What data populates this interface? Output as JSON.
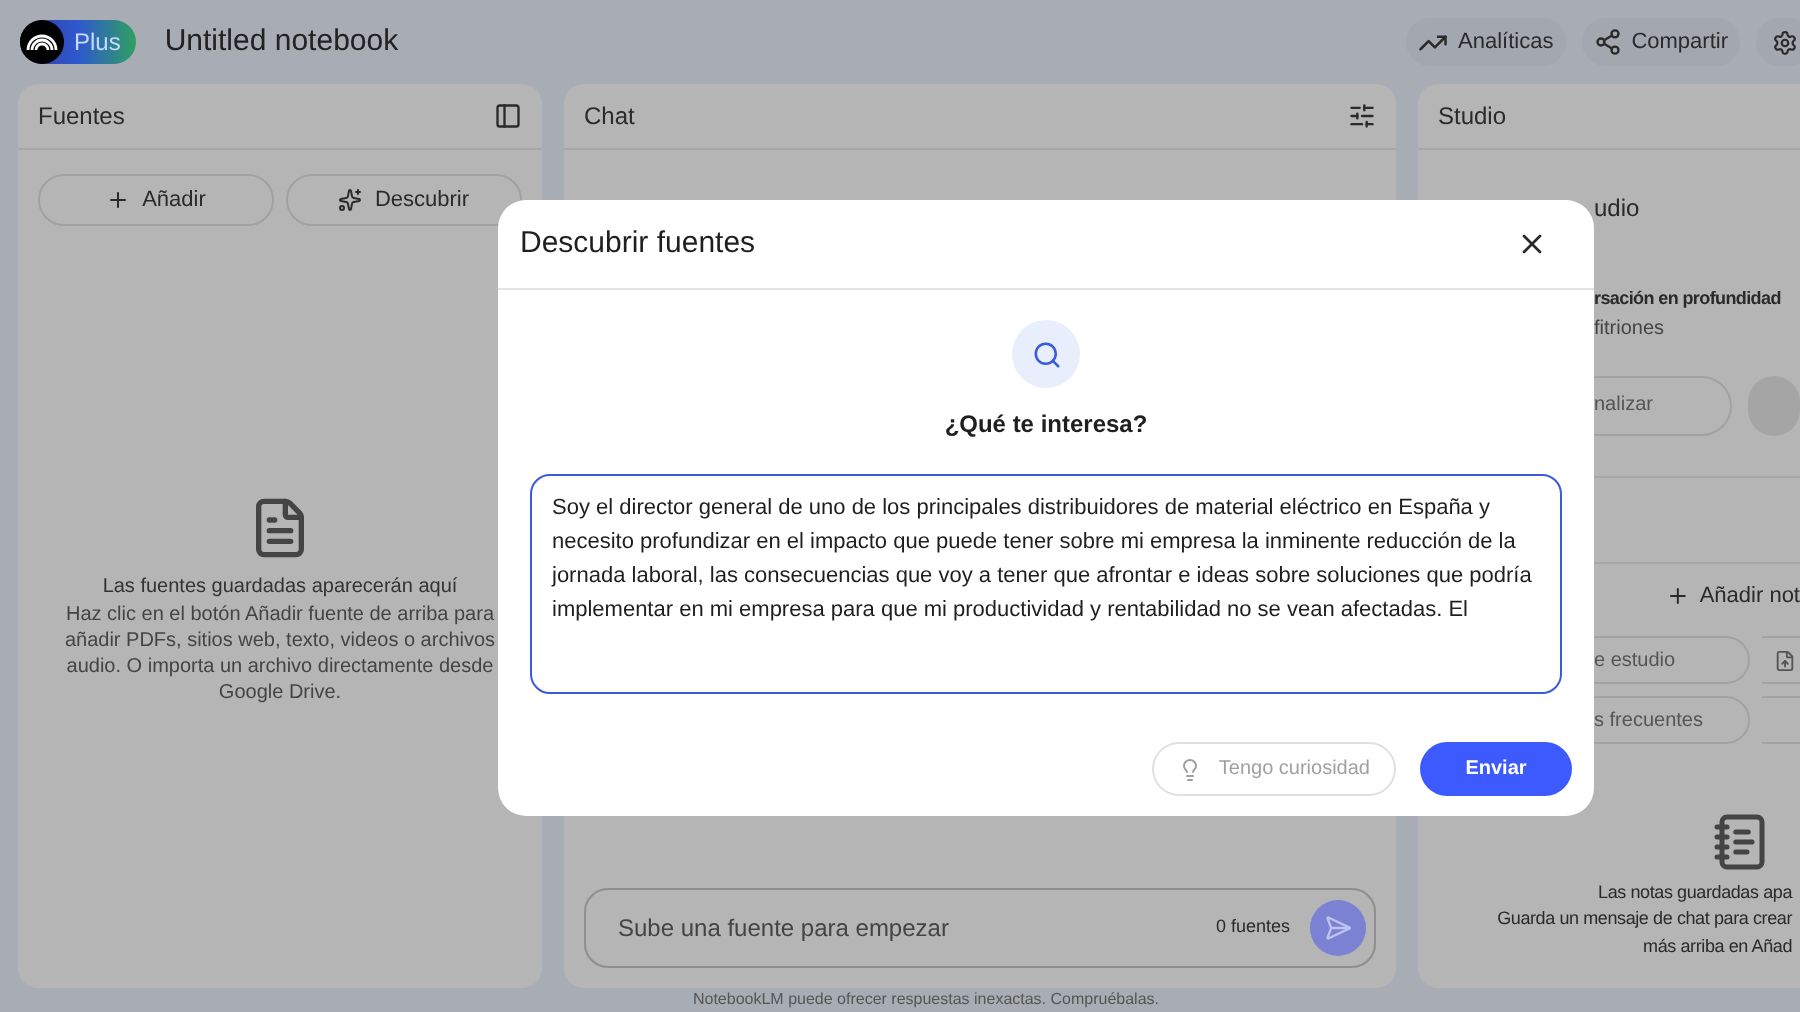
{
  "header": {
    "badge": "Plus",
    "title": "Untitled notebook",
    "actions": [
      {
        "label": "Analíticas",
        "kind": "trend"
      },
      {
        "label": "Compartir",
        "kind": "share"
      },
      {
        "kind": "settings"
      }
    ]
  },
  "sources": {
    "title": "Fuentes",
    "buttons": [
      {
        "label": "Añadir",
        "kind": "add"
      },
      {
        "label": "Descubrir",
        "kind": "discover"
      }
    ],
    "empty_title": "Las fuentes guardadas aparecerán aquí",
    "empty_text": "Haz clic en el botón Añadir fuente de arriba para añadir PDFs, sitios web, texto, videos o archivos audio. O importa un archivo directamente desde Google Drive."
  },
  "chat": {
    "title": "Chat",
    "placeholder": "Sube una fuente para empezar",
    "count": "0 fuentes",
    "disclaimer": "NotebookLM puede ofrecer respuestas inexactas. Compruébalas."
  },
  "studio": {
    "title": "Studio",
    "audio_heading": "udio",
    "card_title": "rsación en profundidad",
    "card_subtitle": "fitriones",
    "customize": "nalizar",
    "add_note": "Añadir not",
    "chips": [
      {
        "label": "e estudio"
      },
      {
        "kind": "icon"
      },
      {
        "label": "s frecuentes"
      },
      {
        "kind": "empty"
      }
    ],
    "empty_title": "Las notas guardadas apa",
    "empty_text": [
      "Guarda un mensaje de chat para crear",
      "más arriba en Añad"
    ]
  },
  "dialog": {
    "title": "Descubrir fuentes",
    "question": "¿Qué te interesa?",
    "value": "Soy el director general de uno de los principales distribuidores de material eléctrico en España y necesito profundizar en el impacto que puede tener sobre mi empresa la inminente reducción de la jornada laboral, las consecuencias que voy a tener que afrontar e ideas sobre soluciones que podría implementar en mi empresa para que mi productividad y rentabilidad no se vean afectadas. El",
    "buttons": [
      {
        "label": "Tengo curiosidad",
        "disabled": true
      },
      {
        "label": "Enviar",
        "disabled": false
      }
    ]
  }
}
